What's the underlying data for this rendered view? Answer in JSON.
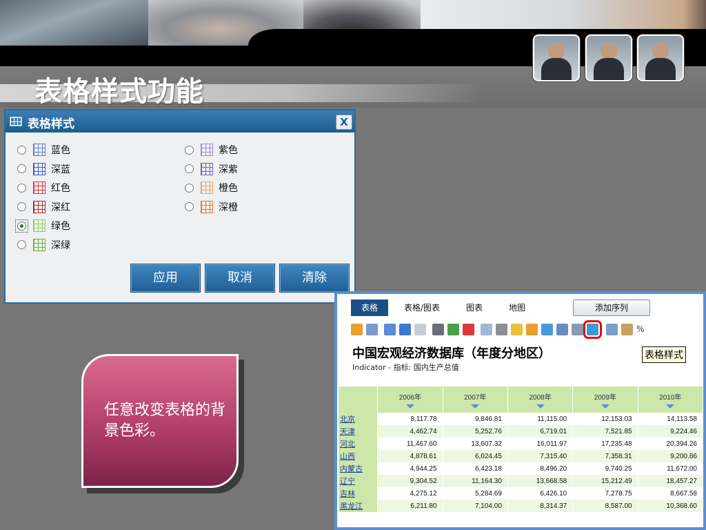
{
  "slide": {
    "title": "表格样式功能",
    "callout": "任意改变表格的背景色彩。"
  },
  "dialog": {
    "title": "表格样式",
    "close_label": "X",
    "options_left": [
      {
        "label": "蓝色",
        "color": "#5b7fd0",
        "checked": false
      },
      {
        "label": "深蓝",
        "color": "#3a5db8",
        "checked": false
      },
      {
        "label": "红色",
        "color": "#d83a3a",
        "checked": false
      },
      {
        "label": "深红",
        "color": "#b02a2a",
        "checked": false
      },
      {
        "label": "绿色",
        "color": "#8fcf5a",
        "checked": true
      },
      {
        "label": "深绿",
        "color": "#6fae3a",
        "checked": false
      }
    ],
    "options_right": [
      {
        "label": "紫色",
        "color": "#a58ad0",
        "checked": false
      },
      {
        "label": "深紫",
        "color": "#7a5fb0",
        "checked": false
      },
      {
        "label": "橙色",
        "color": "#f0a550",
        "checked": false
      },
      {
        "label": "深橙",
        "color": "#e07d20",
        "checked": false
      }
    ],
    "buttons": {
      "apply": "应用",
      "cancel": "取消",
      "clear": "清除"
    }
  },
  "app": {
    "tabs": [
      {
        "label": "表格",
        "active": true
      },
      {
        "label": "表格/图表",
        "active": false
      },
      {
        "label": "图表",
        "active": false
      },
      {
        "label": "地图",
        "active": false
      }
    ],
    "add_series_label": "添加序列",
    "percent_icon_label": "%",
    "tooltip": "表格样式",
    "db_title": "中国宏观经济数据库（年度分地区）",
    "indicator": "Indicator - 指标: 国内生产总值",
    "columns": [
      "2006年",
      "2007年",
      "2008年",
      "2009年",
      "2010年"
    ],
    "rows": [
      {
        "region": "北京",
        "values": [
          "8,117.78",
          "9,846.81",
          "11,115.00",
          "12,153.03",
          "14,113.58"
        ]
      },
      {
        "region": "天津",
        "values": [
          "4,462.74",
          "5,252.76",
          "6,719.01",
          "7,521.85",
          "9,224.46"
        ]
      },
      {
        "region": "河北",
        "values": [
          "11,467.60",
          "13,607.32",
          "16,011.97",
          "17,235.48",
          "20,394.26"
        ]
      },
      {
        "region": "山西",
        "values": [
          "4,878.61",
          "6,024.45",
          "7,315.40",
          "7,358.31",
          "9,200.86"
        ]
      },
      {
        "region": "内蒙古",
        "values": [
          "4,944.25",
          "6,423.18",
          "8,496.20",
          "9,740.25",
          "11,672.00"
        ]
      },
      {
        "region": "辽宁",
        "values": [
          "9,304.52",
          "11,164.30",
          "13,668.58",
          "15,212.49",
          "18,457.27"
        ]
      },
      {
        "region": "吉林",
        "values": [
          "4,275.12",
          "5,284.69",
          "6,426.10",
          "7,278.75",
          "8,667.58"
        ]
      },
      {
        "region": "黑龙江",
        "values": [
          "6,211.80",
          "7,104.00",
          "8,314.37",
          "8,587.00",
          "10,368.60"
        ]
      }
    ]
  }
}
